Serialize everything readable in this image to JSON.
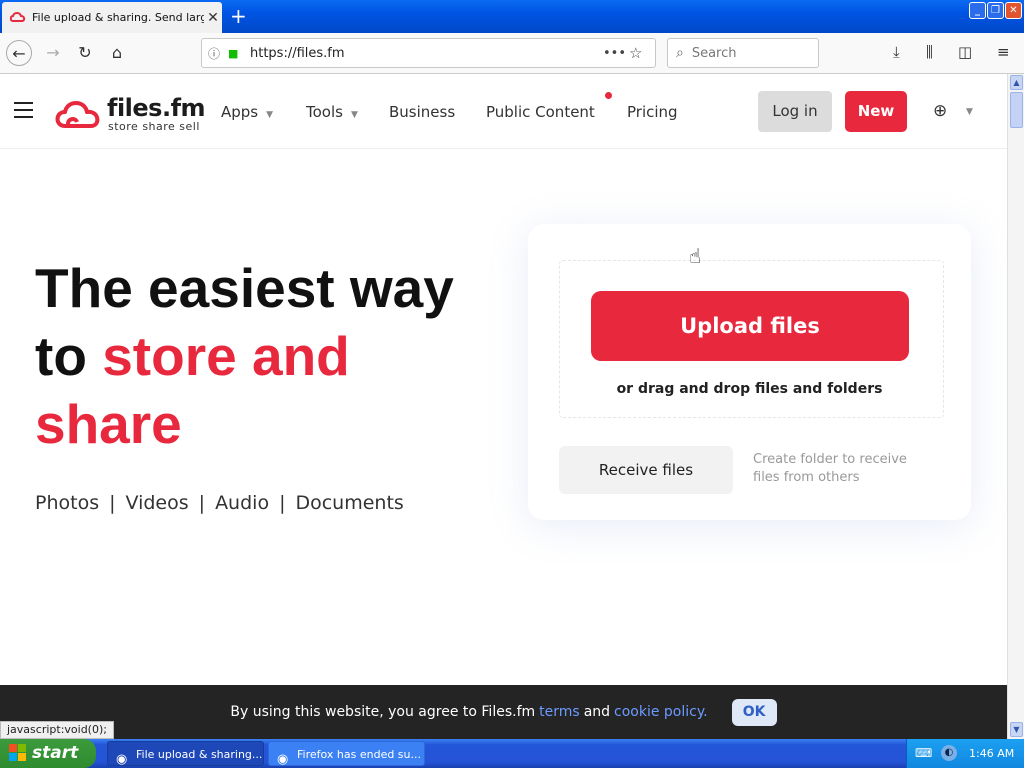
{
  "browser": {
    "tab_title": "File upload & sharing. Send large p",
    "tab_close": "✕",
    "new_tab": "+",
    "url": "https://files.fm",
    "url_more": "•••",
    "search_placeholder": "Search",
    "window_buttons": [
      "_",
      "❐",
      "✕"
    ]
  },
  "site": {
    "logo_name": "files.fm",
    "logo_tagline": "store  share  sell",
    "nav": [
      {
        "label": "Apps",
        "has_caret": true
      },
      {
        "label": "Tools",
        "has_caret": true
      },
      {
        "label": "Business",
        "has_caret": false
      },
      {
        "label": "Public Content",
        "has_caret": false
      },
      {
        "label": "Pricing",
        "has_caret": false
      }
    ],
    "login_label": "Log in",
    "new_label": "New",
    "brand_color": "#e8283d"
  },
  "hero": {
    "line1": "The easiest way",
    "line2_plain": "to ",
    "line2_red": "store and",
    "line3_red": "share",
    "categories": [
      "Photos",
      "Videos",
      "Audio",
      "Documents"
    ]
  },
  "upload_card": {
    "upload_label": "Upload files",
    "drag_hint": "or drag and drop files and folders",
    "receive_label": "Receive files",
    "receive_hint": "Create folder to receive files from others"
  },
  "cookie_banner": {
    "text_before": "By using this website, you agree to Files.fm",
    "terms_link": "terms",
    "and_text": "and",
    "policy_link": "cookie policy.",
    "ok_label": "OK"
  },
  "status_bar": "javascript:void(0);",
  "taskbar": {
    "start_label": "start",
    "tasks": [
      {
        "label": "File upload & sharing....",
        "icon": "firefox-icon",
        "active": true
      },
      {
        "label": "Firefox has ended su...",
        "icon": "firefox-icon",
        "active": false
      }
    ],
    "clock": "1:46 AM"
  }
}
